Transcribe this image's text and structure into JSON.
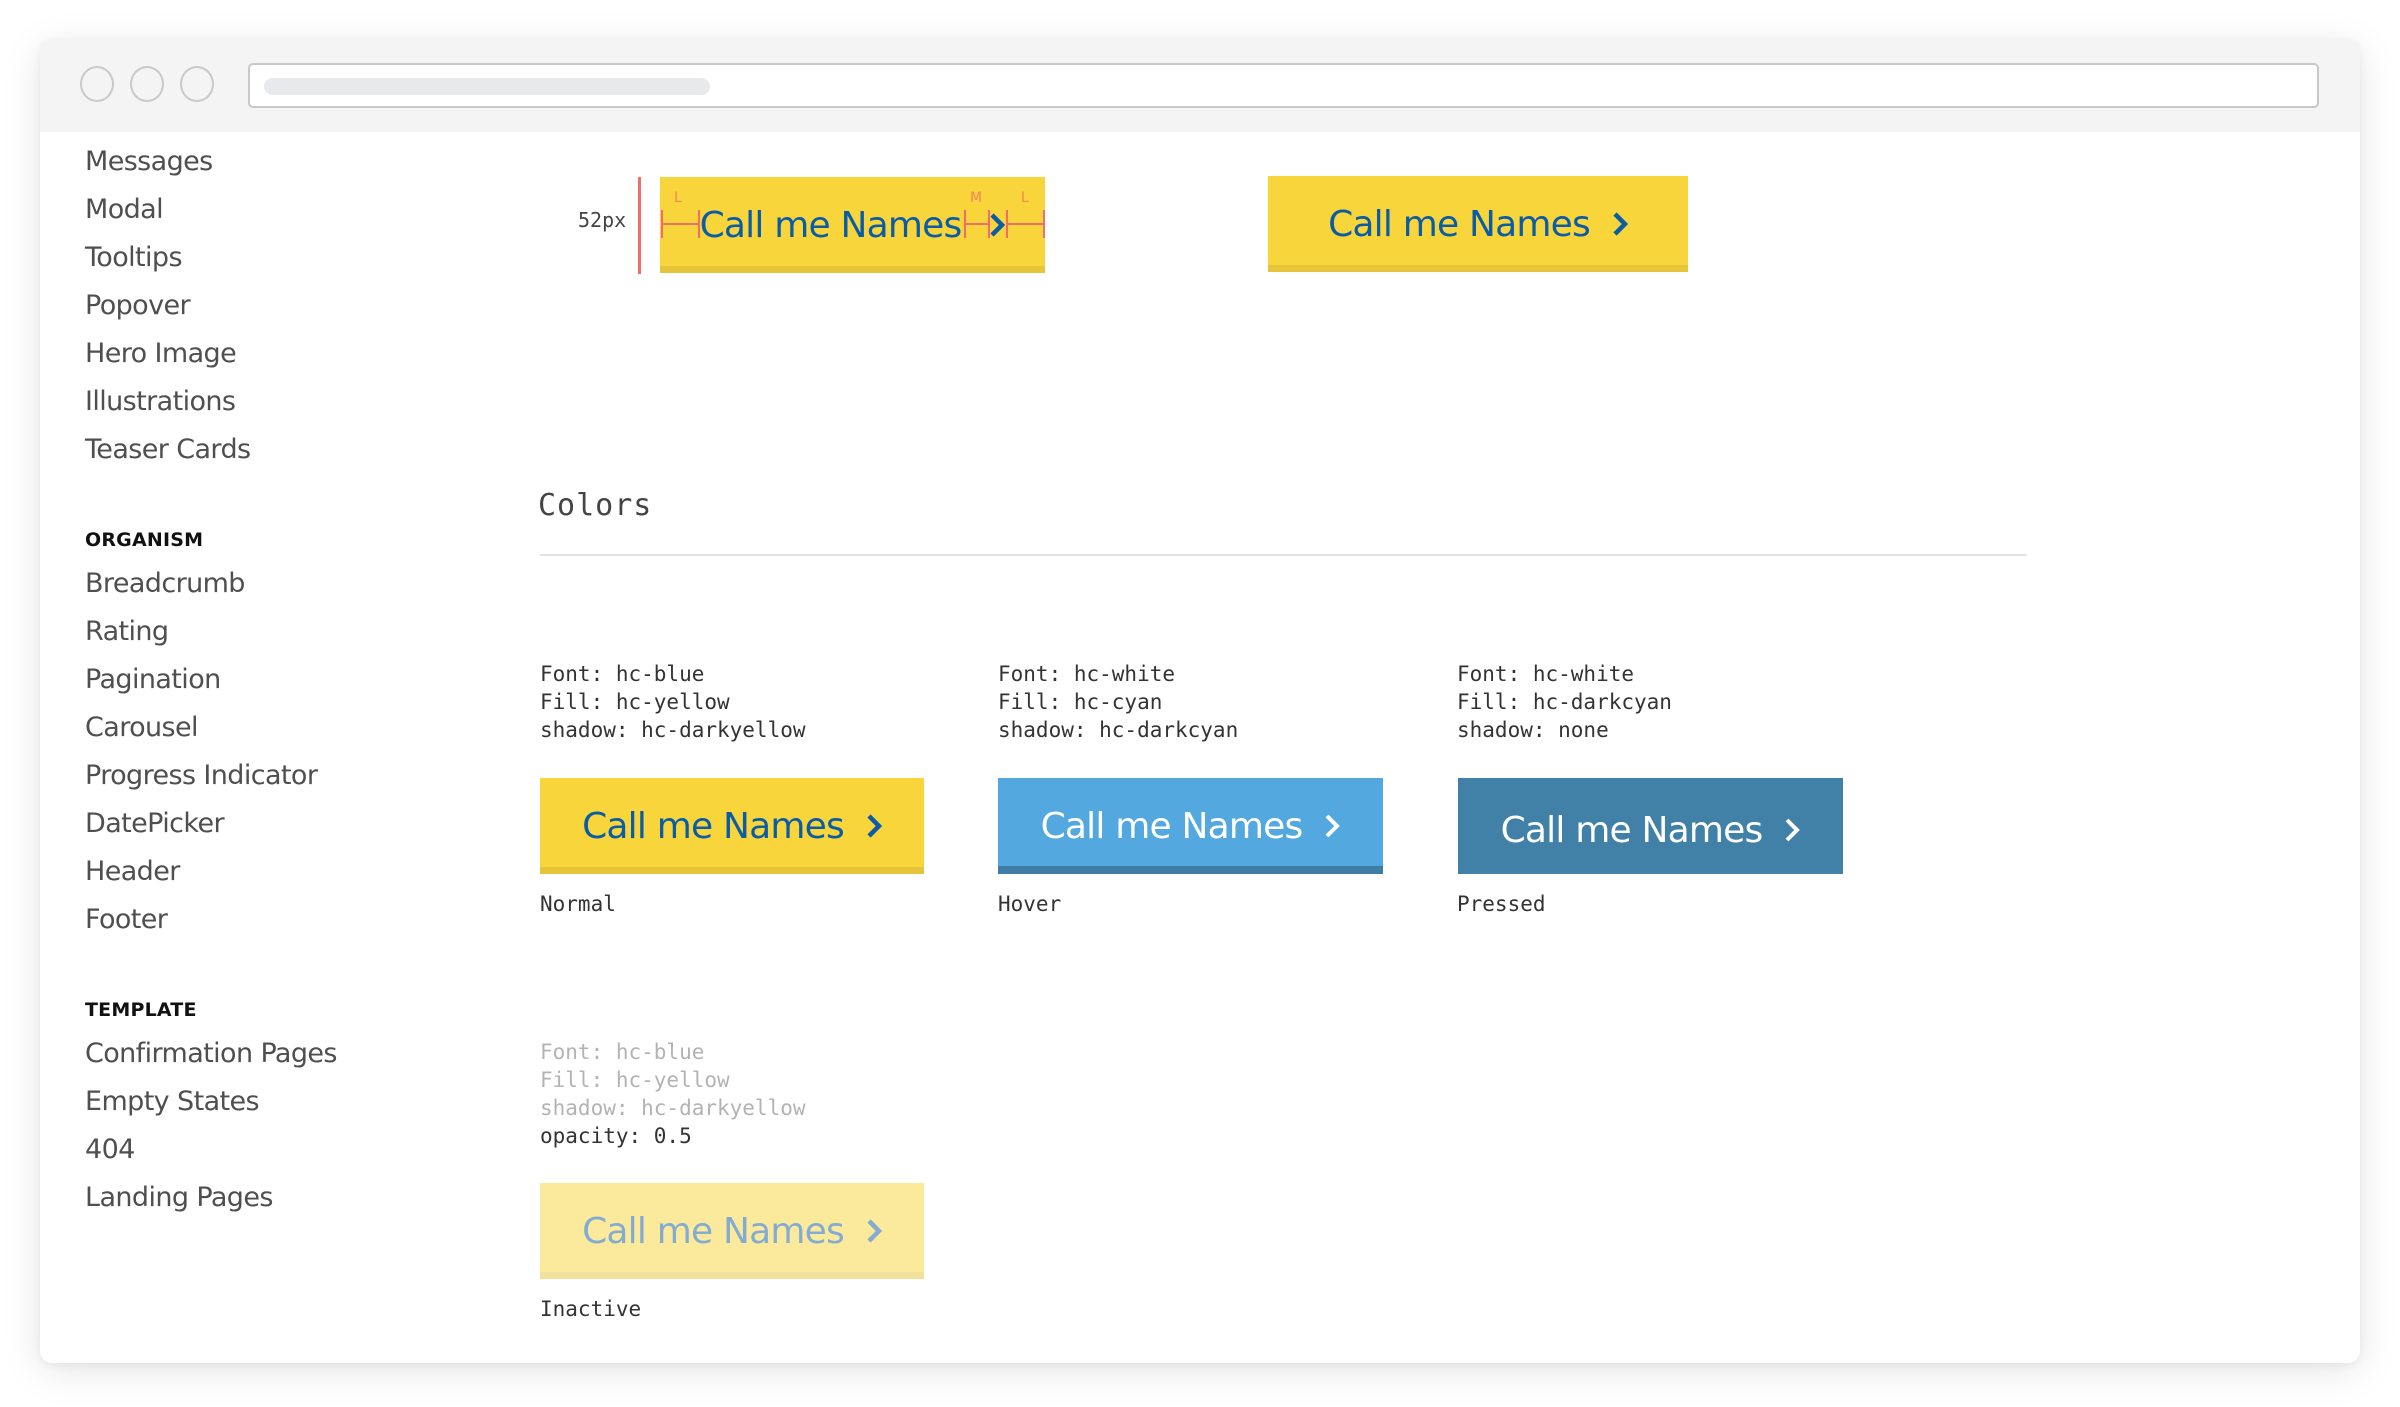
{
  "browser": {
    "address_bar_value": ""
  },
  "sidebar": {
    "groups": [
      {
        "heading": null,
        "items": [
          "Messages",
          "Modal",
          "Tooltips",
          "Popover",
          "Hero Image",
          "Illustrations",
          "Teaser Cards"
        ]
      },
      {
        "heading": "ORGANISM",
        "items": [
          "Breadcrumb",
          "Rating",
          "Pagination",
          "Carousel",
          "Progress Indicator",
          "DatePicker",
          "Header",
          "Footer"
        ]
      },
      {
        "heading": "TEMPLATE",
        "items": [
          "Confirmation Pages",
          "Empty States",
          "404",
          "Landing Pages"
        ]
      }
    ]
  },
  "spacing_demo": {
    "height_label": "52px",
    "spacing_markers": [
      "L",
      "M",
      "L"
    ],
    "button_label": "Call me Names",
    "reference_button_label": "Call me Names",
    "chevron_icon": "chevron-right-icon"
  },
  "colors_section": {
    "title": "Colors",
    "states": [
      {
        "name": "Normal",
        "spec": [
          "Font: hc-blue",
          "Fill: hc-yellow",
          "shadow: hc-darkyellow"
        ],
        "button_label": "Call me Names",
        "fill": "#f8d53b",
        "font_color": "#0b5ca6",
        "shadow": "#e6c53a"
      },
      {
        "name": "Hover",
        "spec": [
          "Font: hc-white",
          "Fill: hc-cyan",
          "shadow: hc-darkcyan"
        ],
        "button_label": "Call me Names",
        "fill": "#52a8df",
        "font_color": "#ffffff",
        "shadow": "#3e7ea6"
      },
      {
        "name": "Pressed",
        "spec": [
          "Font: hc-white",
          "Fill: hc-darkcyan",
          "shadow: none"
        ],
        "button_label": "Call me Names",
        "fill": "#4181a8",
        "font_color": "#ffffff",
        "shadow": "none"
      },
      {
        "name": "Inactive",
        "spec": [
          "Font: hc-blue",
          "Fill: hc-yellow",
          "shadow: hc-darkyellow"
        ],
        "extra_spec": "opacity: 0.5",
        "button_label": "Call me Names",
        "fill": "#f8d53b",
        "font_color": "#0b5ca6",
        "shadow": "#e6c53a",
        "opacity": 0.5
      }
    ]
  },
  "colors": {
    "measure_red": "#f36b6b",
    "sidebar_text": "#4f4f4f"
  }
}
